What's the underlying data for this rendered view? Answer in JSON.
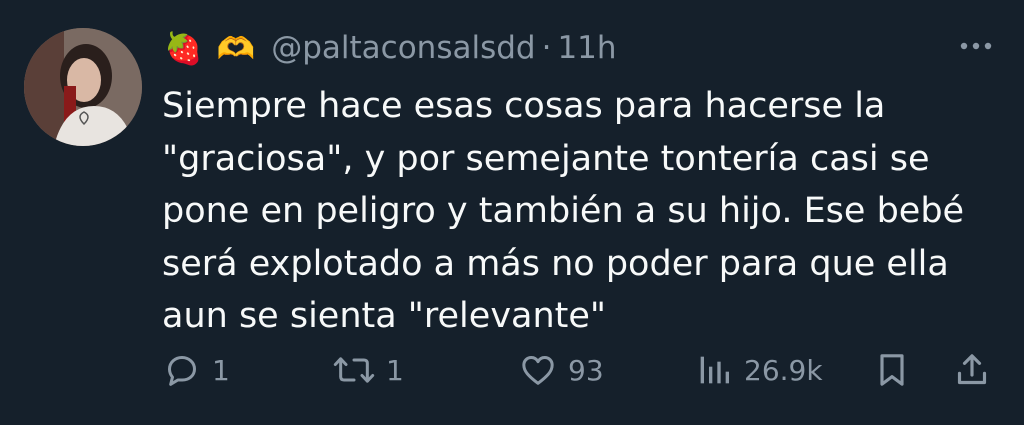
{
  "author": {
    "emojis": [
      "🍓",
      "🫶"
    ],
    "handle": "@paltaconsalsdd",
    "separator": "·",
    "time": "11h"
  },
  "tweet": {
    "lines": [
      "Siempre hace esas cosas para hacerse la",
      "\"graciosa\", y por semejante tontería casi se",
      "pone en peligro y también a su hijo. Ese bebé",
      "será explotado a más no poder para que ella",
      "aun se sienta \"relevante\""
    ]
  },
  "actions": {
    "replies": "1",
    "retweets": "1",
    "likes": "93",
    "views": "26.9k"
  },
  "icons": {
    "more": "more-horizontal-icon",
    "reply": "reply-bubble-icon",
    "retweet": "retweet-icon",
    "like": "heart-icon",
    "views": "views-bar-chart-icon",
    "bookmark": "bookmark-icon",
    "share": "share-upload-icon"
  },
  "colors": {
    "background": "#15202b",
    "text": "#f7f9f9",
    "secondary": "#8b98a5"
  }
}
